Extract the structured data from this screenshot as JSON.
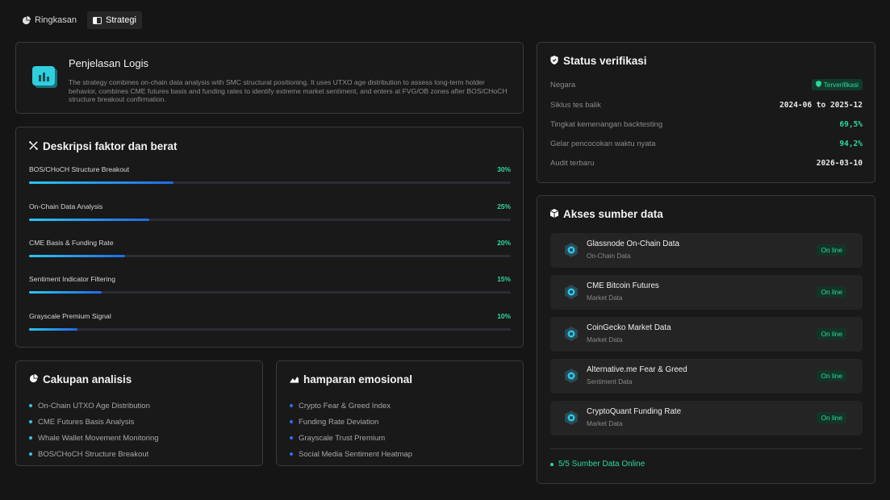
{
  "tabs": [
    {
      "label": "Ringkasan",
      "icon": "pie-chart-icon",
      "active": false
    },
    {
      "label": "Strategi",
      "icon": "panel-icon",
      "active": true
    }
  ],
  "logic": {
    "title": "Penjelasan Logis",
    "text": "The strategy combines on-chain data analysis with SMC structural positioning. It uses UTXO age distribution to assess long-term holder behavior, combines CME futures basis and funding rates to identify extreme market sentiment, and enters at FVG/OB zones after BOS/CHoCH structure breakout confirmation."
  },
  "factors": {
    "title": "Deskripsi faktor dan berat",
    "items": [
      {
        "name": "BOS/CHoCH Structure Breakout",
        "value": "30%",
        "weight": 0.3
      },
      {
        "name": "On-Chain Data Analysis",
        "value": "25%",
        "weight": 0.25
      },
      {
        "name": "CME Basis & Funding Rate",
        "value": "20%",
        "weight": 0.2
      },
      {
        "name": "Sentiment Indicator Filtering",
        "value": "15%",
        "weight": 0.15
      },
      {
        "name": "Grayscale Premium Signal",
        "value": "10%",
        "weight": 0.1
      }
    ]
  },
  "scope": {
    "title": "Cakupan analisis",
    "items": [
      "On-Chain UTXO Age Distribution",
      "CME Futures Basis Analysis",
      "Whale Wallet Movement Monitoring",
      "BOS/CHoCH Structure Breakout"
    ]
  },
  "emotion": {
    "title": "hamparan emosional",
    "items": [
      "Crypto Fear & Greed Index",
      "Funding Rate Deviation",
      "Grayscale Trust Premium",
      "Social Media Sentiment Heatmap"
    ]
  },
  "status": {
    "title": "Status verifikasi",
    "rows": [
      {
        "key": "Negara",
        "value": "Terverifikasi",
        "badge": true
      },
      {
        "key": "Siklus tes balik",
        "value": "2024-06 to 2025-12"
      },
      {
        "key": "Tingkat kemenangan backtesting",
        "value": "69,5%",
        "green": true
      },
      {
        "key": "Gelar pencocokan waktu nyata",
        "value": "94,2%",
        "green": true
      },
      {
        "key": "Audit terbaru",
        "value": "2026-03-10"
      }
    ]
  },
  "sources": {
    "title": "Akses sumber data",
    "items": [
      {
        "name": "Glassnode On-Chain Data",
        "type": "On-Chain Data",
        "status": "On line"
      },
      {
        "name": "CME Bitcoin Futures",
        "type": "Market Data",
        "status": "On line"
      },
      {
        "name": "CoinGecko Market Data",
        "type": "Market Data",
        "status": "On line"
      },
      {
        "name": "Alternative.me Fear & Greed",
        "type": "Sentiment Data",
        "status": "On line"
      },
      {
        "name": "CryptoQuant Funding Rate",
        "type": "Market Data",
        "status": "On line"
      }
    ],
    "summary": "5/5 Sumber Data Online"
  },
  "colors": {
    "accent_green": "#2fd89a",
    "accent_cyan": "#2cc6ee",
    "accent_blue": "#2169e6",
    "background": "#151515"
  }
}
